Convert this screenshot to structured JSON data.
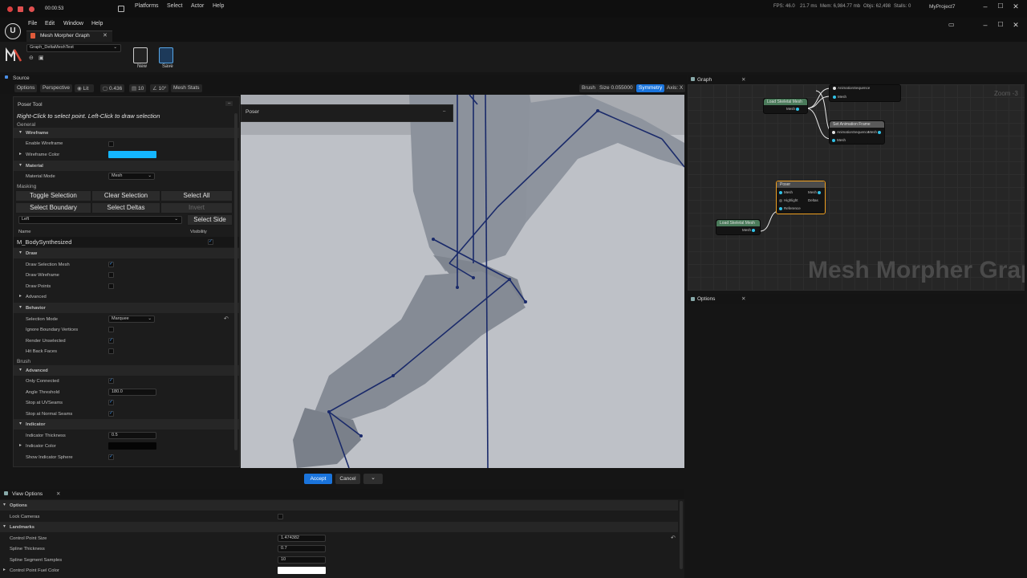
{
  "top_bar": {
    "timer": "00:00:53",
    "menus": [
      "Platforms",
      "Select",
      "Actor",
      "Help"
    ],
    "fps": "FPS: 46.0",
    "ms": "21.7 ms",
    "mem": "Mem: 6,984.77 mb",
    "objs": "Objs: 62,498",
    "stalls": "Stalls: 0",
    "project": "MyProject7"
  },
  "editor_menu": [
    "File",
    "Edit",
    "Window",
    "Help"
  ],
  "tab": {
    "label": "Mesh Morpher Graph"
  },
  "graph_asset": "Graph_DeltaMeshTest",
  "toolbar": {
    "new_label": "New",
    "save_label": "Save"
  },
  "viewport_header": {
    "source_label": "Source",
    "options": "Options",
    "perspective": "Perspective",
    "lit": "Lit",
    "value_a": "0.436",
    "value_b": "10",
    "value_c": "10°",
    "mesh_stats": "Mesh Stats",
    "brush": "Brush",
    "brush_size": "Size 0.055000",
    "symmetry": "Symmetry",
    "axis": "Axis: X"
  },
  "poser_overlay": {
    "title": "Poser"
  },
  "poser_tool": {
    "title": "Poser Tool",
    "hint": "Right-Click to select point. Left-Click to draw selection",
    "general": "General",
    "wireframe": "Wireframe",
    "enable_wireframe": "Enable Wireframe",
    "wireframe_color": "Wireframe Color",
    "wireframe_color_hex": "#14b6ff",
    "material": "Material",
    "material_mode": "Material Mode",
    "material_mode_value": "Mesh",
    "masking": "Masking",
    "toggle_selection": "Toggle Selection",
    "clear_selection": "Clear Selection",
    "select_all": "Select All",
    "select_boundary": "Select Boundary",
    "select_deltas": "Select Deltas",
    "invert": "Invert",
    "side_value": "Left",
    "select_side": "Select Side",
    "name_col": "Name",
    "visibility_col": "Visibility",
    "mesh_name": "M_BodySynthesized",
    "draw": "Draw",
    "draw_selection_mesh": "Draw Selection Mesh",
    "draw_wireframe": "Draw Wireframe",
    "draw_points": "Draw Points",
    "advanced": "Advanced",
    "behavior": "Behavior",
    "selection_mode": "Selection Mode",
    "selection_mode_value": "Marquee",
    "ignore_boundary": "Ignore Boundary Vertices",
    "render_unselected": "Render Unselected",
    "hit_back_faces": "Hit Back Faces",
    "brush": "Brush",
    "brush_advanced": "Advanced",
    "only_connected": "Only Connected",
    "angle_threshold": "Angle Threshold",
    "angle_threshold_value": "180.0",
    "stop_uv": "Stop at UVSeams",
    "stop_normal": "Stop at Normal Seams",
    "indicator": "Indicator",
    "indicator_thickness": "Indicator Thickness",
    "indicator_thickness_value": "0.5",
    "indicator_color": "Indicator Color",
    "show_indicator_sphere": "Show Indicator Sphere"
  },
  "actions": {
    "accept": "Accept",
    "cancel": "Cancel"
  },
  "view_options": {
    "title": "View Options",
    "options": "Options",
    "lock_cameras": "Lock Cameras",
    "landmarks": "Landmarks",
    "control_point_size": "Control Point Size",
    "control_point_size_value": "1.474382",
    "spline_thickness": "Spline Thickness",
    "spline_thickness_value": "0.7",
    "spline_segment_samples": "Spline Segment Samples",
    "spline_segment_samples_value": "10",
    "control_point_fuel_color": "Control Point Fuel Color"
  },
  "graph": {
    "title": "Graph",
    "zoom": "Zoom -3",
    "watermark": "Mesh Morpher Graph",
    "nodes": {
      "load1": "Load Skeletal Mesh",
      "load2": "Load Skeletal Mesh",
      "set_anim": "Set Animation Frame",
      "poser": "Poser",
      "pin_mesh": "Mesh",
      "pin_anim": "AnimationSequence",
      "pin_highlight": "Highlight",
      "pin_reference": "Reference",
      "pin_deltas": "Deltas"
    }
  },
  "options_panel": {
    "title": "Options"
  }
}
